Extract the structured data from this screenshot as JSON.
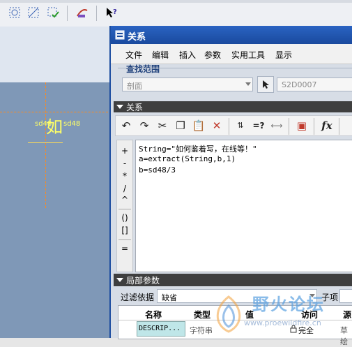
{
  "dialog": {
    "title": "关系",
    "menu": [
      "文件",
      "编辑",
      "插入",
      "参数",
      "实用工具",
      "显示"
    ],
    "search_section": "查找范围",
    "scope_value": "剖面",
    "object_value": "S2D0007",
    "relations_section": "关系",
    "relation_lines": [
      "String=\"如何鉴着写，在线等！\"",
      "a=extract(String,b,1)",
      "b=sd48/3"
    ],
    "operators": [
      "+",
      "-",
      "*",
      "/",
      "^",
      "()",
      "[]",
      "="
    ],
    "local_params_section": "局部参数",
    "filter_label": "过滤依据",
    "filter_value": "缺省",
    "subitem_label": "子项",
    "table": {
      "headers": [
        "名称",
        "类型",
        "值",
        "访问",
        "源"
      ],
      "row": {
        "name": "DESCRIP...",
        "type": "字符串",
        "access": "完全",
        "source": "草绘"
      }
    }
  },
  "canvas": {
    "sketch_char": "如",
    "dim_label": "sd48"
  },
  "watermark": {
    "text": "野火论坛",
    "url_fragment": "www.proewildfire.cn"
  },
  "colors": {
    "title_bar": "#1a4a9e",
    "canvas_bg": "#7f98b7",
    "centerline": "#ff8a1c",
    "sketch_text": "#ffff66",
    "section_bar": "#3f3f3f"
  }
}
